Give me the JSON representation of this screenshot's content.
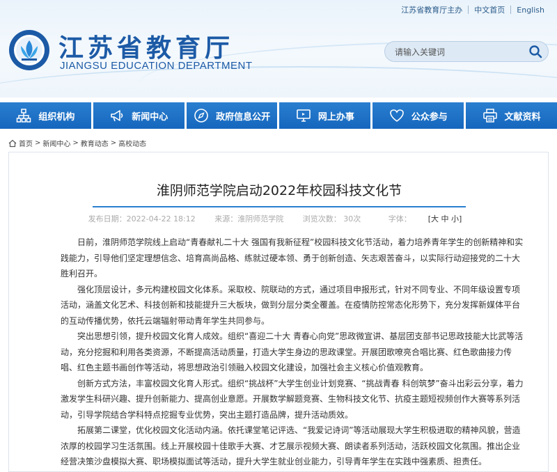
{
  "top_links": {
    "host": "江苏省教育厅主办",
    "chinese": "中文首页",
    "english": "English"
  },
  "brand": {
    "name_cn": "江苏省教育厅",
    "name_en": "JIANGSU EDUCATION DEPARTMENT"
  },
  "search": {
    "placeholder": "请输入关键词"
  },
  "nav": [
    {
      "label": "组织机构",
      "icon": "org-chart-icon"
    },
    {
      "label": "新闻中心",
      "icon": "megaphone-icon"
    },
    {
      "label": "政府信息公开",
      "icon": "compass-icon"
    },
    {
      "label": "网上办事",
      "icon": "monitor-icon"
    },
    {
      "label": "公众参与",
      "icon": "heart-icon"
    },
    {
      "label": "文献资料",
      "icon": "printer-icon"
    }
  ],
  "breadcrumb": [
    "首页",
    "新闻中心",
    "教育动态",
    "高校动态"
  ],
  "breadcrumb_sep": ">",
  "article": {
    "title": "淮阴师范学院启动2022年校园科技文化节",
    "date": "发布日期：2022-04-22 18:12",
    "source": "来源：淮阴师范学院",
    "views": "浏览次数： 30次",
    "font_label": "字体：",
    "font_sizes": "[大 中 小]",
    "paragraphs": [
      "日前，淮阴师范学院线上启动“青春献礼二十大 强国有我新征程”校园科技文化节活动，着力培养青年学生的创新精神和实践能力，引导他们坚定理想信念、培育高尚品格、练就过硬本领、勇于创新创造、矢志艰苦奋斗，以实际行动迎接党的二十大胜利召开。",
      "强化顶层设计，多元构建校园文化体系。采取校、院联动的方式，通过项目申报形式，针对不同专业、不同年级设置专项活动，涵盖文化艺术、科技创新和技能提升三大板块，做到分层分类全覆盖。在疫情防控常态化形势下，充分发挥新媒体平台的互动传播优势，依托云端辐射带动青年学生共同参与。",
      "突出思想引领，提升校园文化育人成效。组织“喜迎二十大 青春心向党”思政微宣讲、基层团支部书记思政技能大比武等活动，充分挖掘和利用各类资源，不断提高活动质量，打造大学生身边的思政课堂。开展团歌嘹亮合唱比赛、红色歌曲接力传唱、红色主题书画创作等活动，将思想政治引领融入校园文化建设，加强社会主义核心价值观教育。",
      "创新方式方法，丰富校园文化育人形式。组织“挑战杯”大学生创业计划竞赛、“挑战青春 科创筑梦”奋斗出彩云分享，着力激发学生科研兴趣、提升创新能力、提高创业意愿。开展数学解题竞赛、生物科技文化节、抗疫主题短视频创作大赛等系列活动，引导学院结合学科特点挖掘专业优势，突出主题打造品牌，提升活动质效。",
      "拓展第二课堂，优化校园文化活动内涵。依托课堂笔记评选、“我爱记诗词”等活动展现大学生积极进取的精神风貌，营造浓厚的校园学习生活氛围。线上开展校园十佳歌手大赛、才艺展示视频大赛、朗读者系列活动，活跃校园文化氛围。推出企业经营决策沙盘模拟大赛、职场模拟面试等活动，提升大学生就业创业能力，引导青年学生在实践中强素质、担责任。"
    ]
  },
  "colors": {
    "brand_blue": "#1c5aa6",
    "nav_blue": "#1d6fc6"
  }
}
